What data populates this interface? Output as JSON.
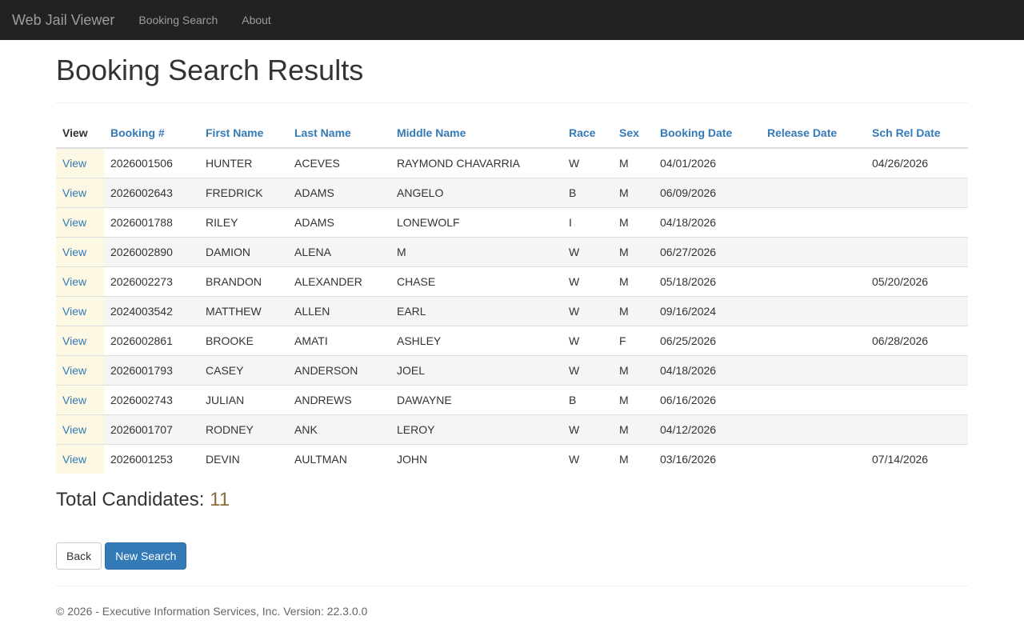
{
  "nav": {
    "brand": "Web Jail Viewer",
    "links": [
      "Booking Search",
      "About"
    ]
  },
  "page": {
    "title": "Booking Search Results"
  },
  "table": {
    "view_header": "View",
    "headers": [
      "Booking #",
      "First Name",
      "Last Name",
      "Middle Name",
      "Race",
      "Sex",
      "Booking Date",
      "Release Date",
      "Sch Rel Date"
    ],
    "view_label": "View",
    "rows": [
      [
        "2026001506",
        "HUNTER",
        "ACEVES",
        "RAYMOND CHAVARRIA",
        "W",
        "M",
        "04/01/2026",
        "",
        "04/26/2026"
      ],
      [
        "2026002643",
        "FREDRICK",
        "ADAMS",
        "ANGELO",
        "B",
        "M",
        "06/09/2026",
        "",
        ""
      ],
      [
        "2026001788",
        "RILEY",
        "ADAMS",
        "LONEWOLF",
        "I",
        "M",
        "04/18/2026",
        "",
        ""
      ],
      [
        "2026002890",
        "DAMION",
        "ALENA",
        "M",
        "W",
        "M",
        "06/27/2026",
        "",
        ""
      ],
      [
        "2026002273",
        "BRANDON",
        "ALEXANDER",
        "CHASE",
        "W",
        "M",
        "05/18/2026",
        "",
        "05/20/2026"
      ],
      [
        "2024003542",
        "MATTHEW",
        "ALLEN",
        "EARL",
        "W",
        "M",
        "09/16/2024",
        "",
        ""
      ],
      [
        "2026002861",
        "BROOKE",
        "AMATI",
        "ASHLEY",
        "W",
        "F",
        "06/25/2026",
        "",
        "06/28/2026"
      ],
      [
        "2026001793",
        "CASEY",
        "ANDERSON",
        "JOEL",
        "W",
        "M",
        "04/18/2026",
        "",
        ""
      ],
      [
        "2026002743",
        "JULIAN",
        "ANDREWS",
        "DAWAYNE",
        "B",
        "M",
        "06/16/2026",
        "",
        ""
      ],
      [
        "2026001707",
        "RODNEY",
        "ANK",
        "LEROY",
        "W",
        "M",
        "04/12/2026",
        "",
        ""
      ],
      [
        "2026001253",
        "DEVIN",
        "AULTMAN",
        "JOHN",
        "W",
        "M",
        "03/16/2026",
        "",
        "07/14/2026"
      ]
    ]
  },
  "summary": {
    "label": "Total Candidates:",
    "count": "11"
  },
  "buttons": {
    "back": "Back",
    "new_search": "New Search"
  },
  "footer": {
    "text": "© 2026 - Executive Information Services, Inc. Version: 22.3.0.0"
  },
  "colors": {
    "navbar": "#222222",
    "link": "#337ab7",
    "view_highlight": "#fcf8e3",
    "count": "#8a6d3b"
  }
}
